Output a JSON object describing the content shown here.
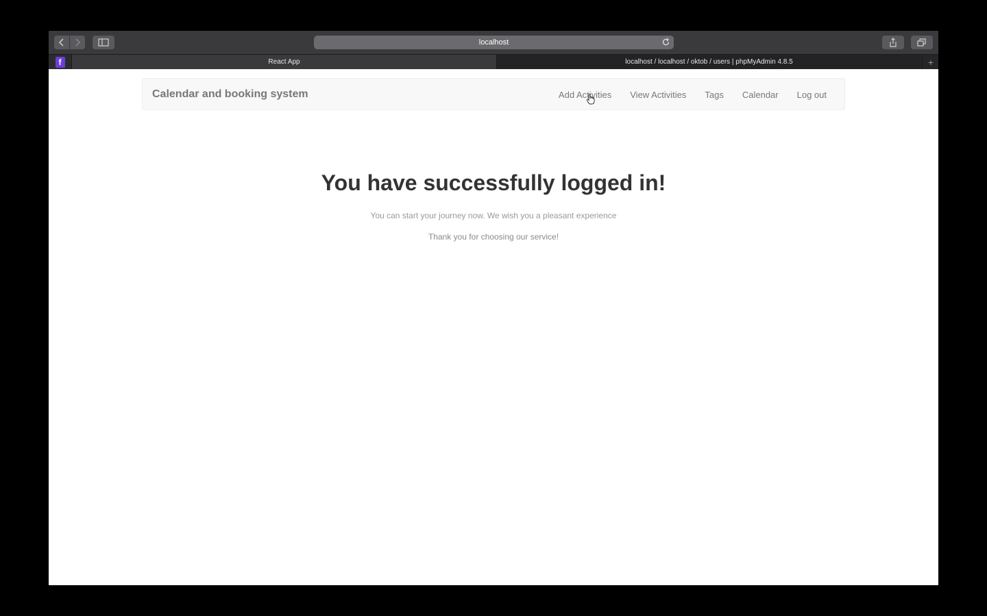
{
  "browser": {
    "address": "localhost",
    "tabs": [
      {
        "title": "React App"
      },
      {
        "title": "localhost / localhost / oktob / users | phpMyAdmin 4.8.5"
      }
    ],
    "favorite_tab_icon": "f",
    "new_tab_label": "+"
  },
  "navbar": {
    "brand": "Calendar and booking system",
    "links": [
      {
        "label": "Add Activities"
      },
      {
        "label": "View Activities"
      },
      {
        "label": "Tags"
      },
      {
        "label": "Calendar"
      },
      {
        "label": "Log out"
      }
    ]
  },
  "main": {
    "heading": "You have successfully logged in!",
    "subtitle": "You can start your journey now. We wish you a pleasant experience",
    "thanks": "Thank you for choosing our service!"
  }
}
